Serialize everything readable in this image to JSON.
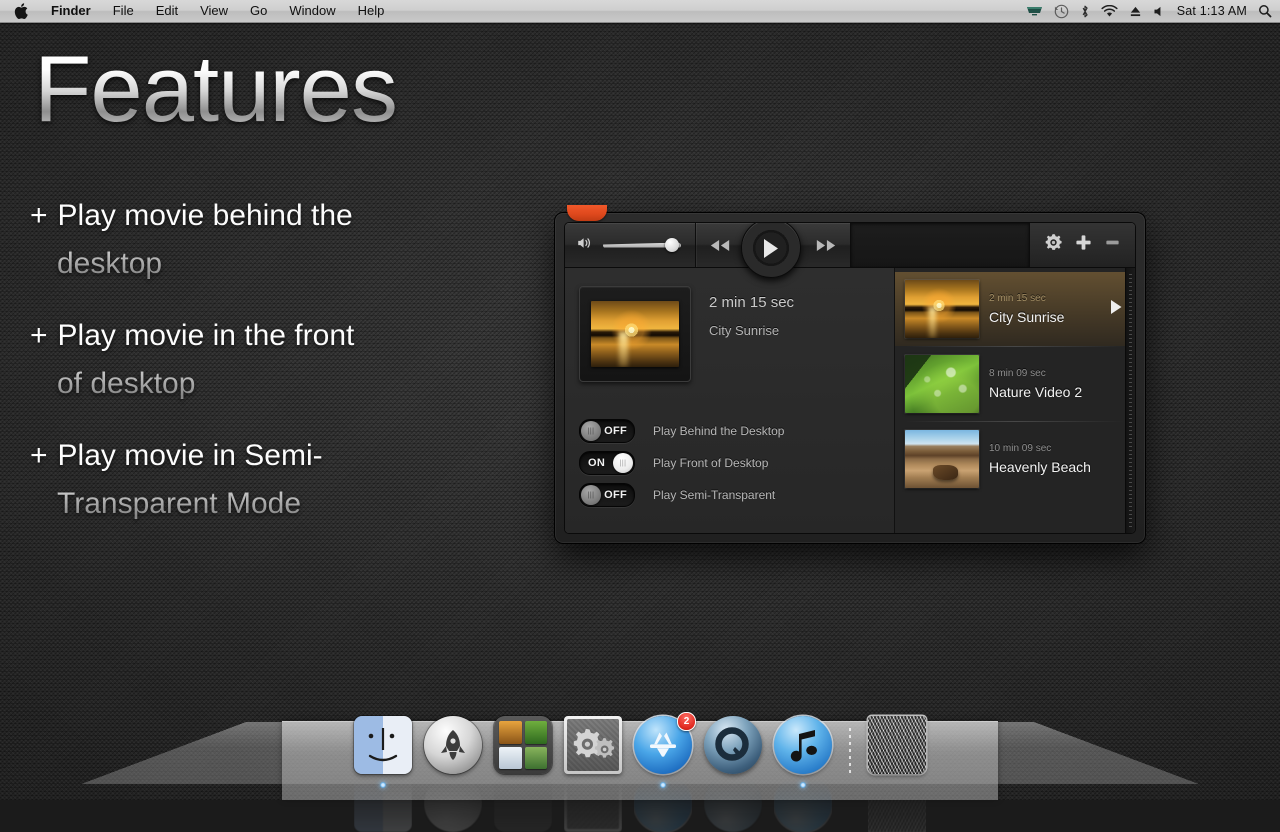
{
  "menubar": {
    "apple_icon": "apple-logo-icon",
    "items": [
      {
        "label": "Finder",
        "bold": true
      },
      {
        "label": "File",
        "bold": false
      },
      {
        "label": "Edit",
        "bold": false
      },
      {
        "label": "View",
        "bold": false
      },
      {
        "label": "Go",
        "bold": false
      },
      {
        "label": "Window",
        "bold": false
      },
      {
        "label": "Help",
        "bold": false
      }
    ],
    "status_icons": [
      "screen-sharing-icon",
      "time-machine-icon",
      "bluetooth-icon",
      "wifi-icon",
      "eject-icon",
      "volume-icon"
    ],
    "clock": "Sat 1:13 AM",
    "search_icon": "spotlight-search-icon"
  },
  "headline": "Features",
  "features": [
    {
      "bullet": "+",
      "line1": "Play movie behind the",
      "line2": "desktop"
    },
    {
      "bullet": "+",
      "line1": "Play movie in the front",
      "line2": "of desktop"
    },
    {
      "bullet": "+",
      "line1": "Play movie in Semi-",
      "line2": "Transparent Mode"
    }
  ],
  "player": {
    "toolbar": {
      "volume_icon": "volume-speaker-icon",
      "volume_value": 80,
      "rewind_icon": "rewind-icon",
      "play_icon": "play-icon",
      "forward_icon": "fast-forward-icon",
      "gear_icon": "gear-icon",
      "add_icon": "plus-icon",
      "remove_icon": "minus-icon"
    },
    "now_playing": {
      "duration": "2 min 15 sec",
      "title": "City Sunrise",
      "artwork": "sunrise-thumbnail"
    },
    "toggles": [
      {
        "state": "OFF",
        "on": false,
        "label": "Play Behind the Desktop"
      },
      {
        "state": "ON",
        "on": true,
        "label": "Play Front of Desktop"
      },
      {
        "state": "OFF",
        "on": false,
        "label": "Play Semi-Transparent"
      }
    ],
    "playlist": [
      {
        "duration": "2 min 15 sec",
        "title": "City Sunrise",
        "active": true,
        "artwork": "sunrise-thumbnail",
        "play_icon": "play-triangle-icon"
      },
      {
        "duration": "8 min 09 sec",
        "title": "Nature Video 2",
        "active": false,
        "artwork": "leaf-thumbnail",
        "play_icon": ""
      },
      {
        "duration": "10 min 09 sec",
        "title": "Heavenly Beach",
        "active": false,
        "artwork": "beach-thumbnail",
        "play_icon": ""
      }
    ]
  },
  "dock": {
    "items": [
      {
        "name": "finder",
        "label": "Finder",
        "running": true,
        "badge": ""
      },
      {
        "name": "launchpad",
        "label": "Launchpad",
        "running": false,
        "badge": ""
      },
      {
        "name": "mission-control",
        "label": "Mission Control",
        "running": false,
        "badge": ""
      },
      {
        "name": "system-preferences",
        "label": "System Preferences",
        "running": false,
        "badge": ""
      },
      {
        "name": "app-store",
        "label": "App Store",
        "running": true,
        "badge": "2"
      },
      {
        "name": "quicktime-player",
        "label": "QuickTime Player",
        "running": false,
        "badge": ""
      },
      {
        "name": "itunes",
        "label": "iTunes",
        "running": true,
        "badge": ""
      },
      {
        "name": "trash",
        "label": "Trash",
        "running": false,
        "badge": ""
      }
    ]
  },
  "colors": {
    "accent_orange": "#e0491d",
    "playlist_highlight": "#96733c",
    "badge_red": "#e02a20",
    "running_dot_blue": "#69b4ee"
  }
}
